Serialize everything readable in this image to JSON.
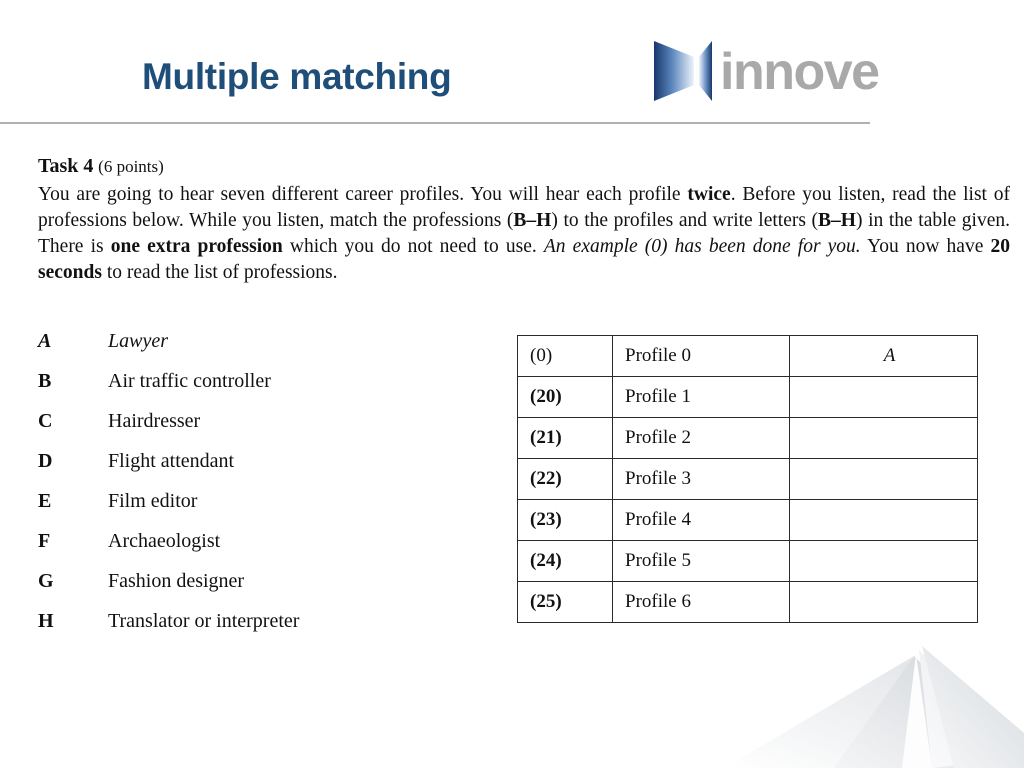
{
  "header": {
    "title": "Multiple matching",
    "brand_name": "innove",
    "brand_colors": {
      "title_navy": "#1f4e79",
      "mark_blue_dark": "#1b3f76",
      "mark_blue_light": "#cfe0f2",
      "wordmark_grey": "#a9a9a9",
      "rule_grey": "#b0b0b0"
    }
  },
  "task": {
    "label": "Task 4",
    "points": "(6 points)",
    "instructions_segments": [
      {
        "text": "You are going to hear seven different career profiles. You will hear each profile ",
        "style": "normal"
      },
      {
        "text": "twice",
        "style": "bold"
      },
      {
        "text": ". Before you listen, read the list of professions below. While you listen, match the professions (",
        "style": "normal"
      },
      {
        "text": "B–H",
        "style": "bold"
      },
      {
        "text": ") to the profiles and write letters (",
        "style": "normal"
      },
      {
        "text": "B–H",
        "style": "bold"
      },
      {
        "text": ") in the table given. There is ",
        "style": "normal"
      },
      {
        "text": "one extra profession",
        "style": "bold"
      },
      {
        "text": " which you do not need to use. ",
        "style": "normal"
      },
      {
        "text": "An example (0) has been done for you.",
        "style": "italic"
      },
      {
        "text": "  You now have ",
        "style": "normal"
      },
      {
        "text": "20 seconds",
        "style": "bold"
      },
      {
        "text": " to read the list of professions.",
        "style": "normal"
      }
    ]
  },
  "professions": [
    {
      "letter": "A",
      "name": "Lawyer",
      "example": true
    },
    {
      "letter": "B",
      "name": "Air traffic controller",
      "example": false
    },
    {
      "letter": "C",
      "name": "Hairdresser",
      "example": false
    },
    {
      "letter": "D",
      "name": "Flight attendant",
      "example": false
    },
    {
      "letter": "E",
      "name": "Film editor",
      "example": false
    },
    {
      "letter": "F",
      "name": "Archaeologist",
      "example": false
    },
    {
      "letter": "G",
      "name": "Fashion designer",
      "example": false
    },
    {
      "letter": "H",
      "name": "Translator or interpreter",
      "example": false
    }
  ],
  "answer_table": {
    "rows": [
      {
        "number": "(0)",
        "profile": "Profile 0",
        "answer": "A",
        "example": true
      },
      {
        "number": "(20)",
        "profile": "Profile 1",
        "answer": "",
        "example": false
      },
      {
        "number": "(21)",
        "profile": "Profile 2",
        "answer": "",
        "example": false
      },
      {
        "number": "(22)",
        "profile": "Profile 3",
        "answer": "",
        "example": false
      },
      {
        "number": "(23)",
        "profile": "Profile 4",
        "answer": "",
        "example": false
      },
      {
        "number": "(24)",
        "profile": "Profile 5",
        "answer": "",
        "example": false
      },
      {
        "number": "(25)",
        "profile": "Profile 6",
        "answer": "",
        "example": false
      }
    ]
  }
}
